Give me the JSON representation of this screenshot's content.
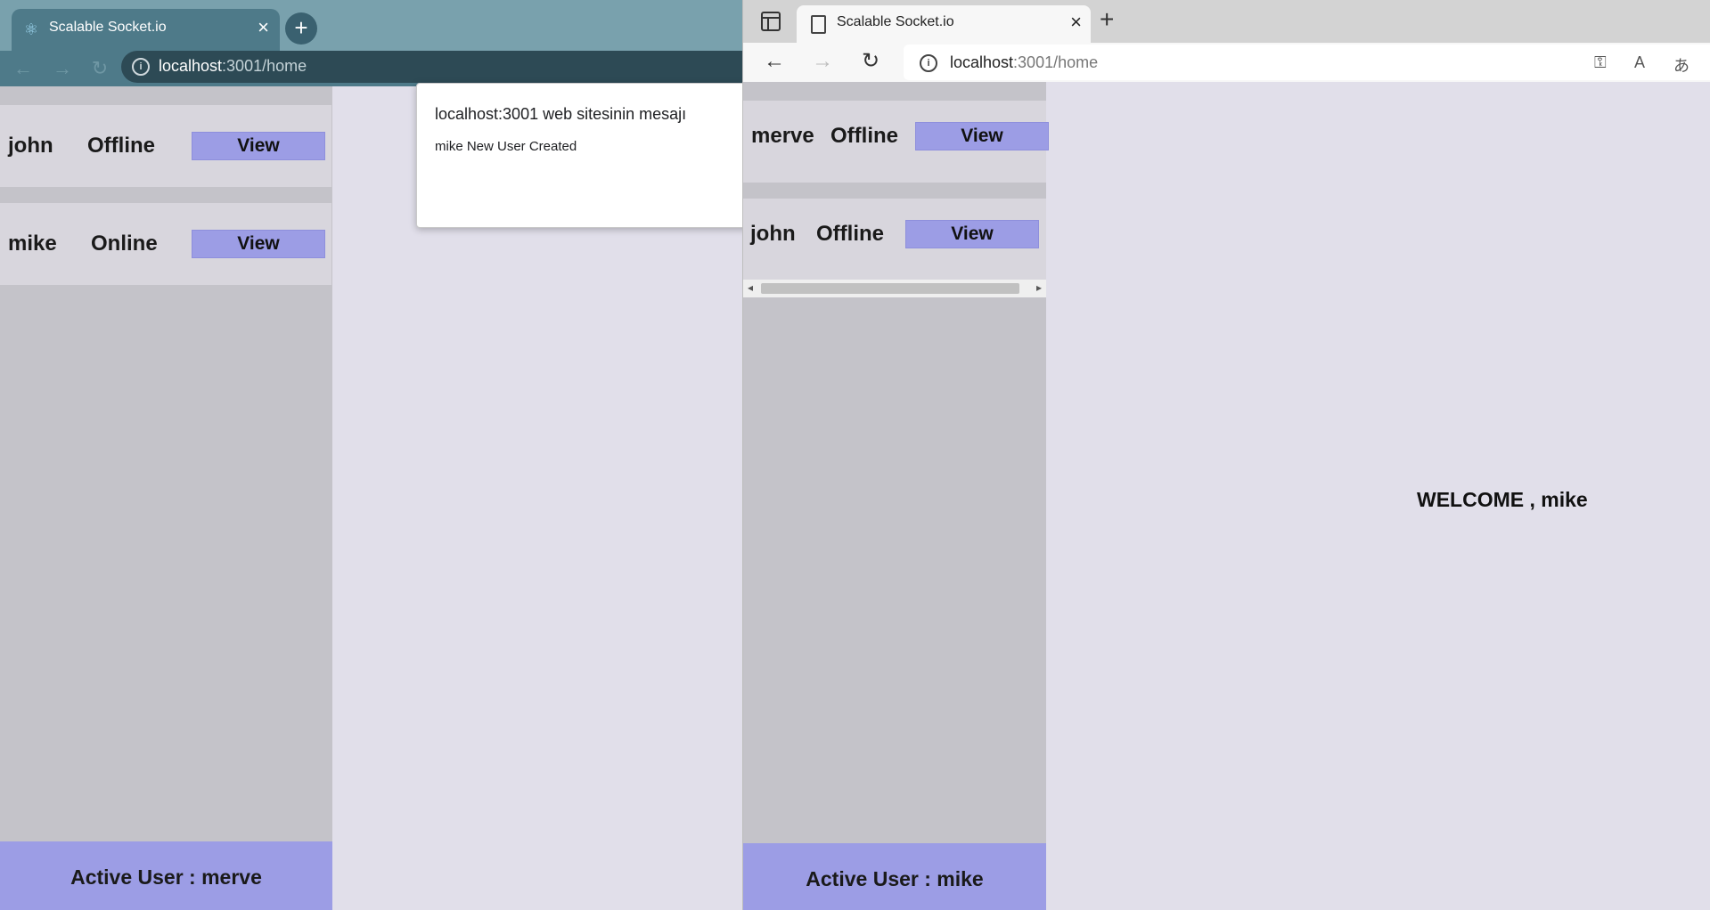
{
  "left_browser": {
    "tab_title": "Scalable Socket.io",
    "url_host": "localhost",
    "url_path": ":3001/home",
    "users": [
      {
        "name": "john",
        "status": "Offline",
        "button": "View"
      },
      {
        "name": "mike",
        "status": "Online",
        "button": "View"
      }
    ],
    "active_user": "Active User : merve",
    "alert": {
      "title": "localhost:3001 web sitesinin mesajı",
      "message": "mike New User Created"
    }
  },
  "right_browser": {
    "tab_title": "Scalable Socket.io",
    "url_host": "localhost",
    "url_path": ":3001/home",
    "users": [
      {
        "name": "merve",
        "status": "Offline",
        "button": "View"
      },
      {
        "name": "john",
        "status": "Offline",
        "button": "View"
      }
    ],
    "active_user": "Active User : mike",
    "welcome": "WELCOME , mike"
  },
  "icons": {
    "react": "react-logo-icon",
    "close": "close-icon",
    "new_tab": "plus-icon",
    "back": "back-arrow-icon",
    "forward": "forward-arrow-icon",
    "reload": "reload-icon",
    "info": "info-icon",
    "key": "key-icon",
    "read_aloud": "read-aloud-icon",
    "translate": "translate-icon",
    "favorite": "star-icon"
  },
  "colors": {
    "accent": "#9c9de5",
    "sidebar": "#c4c3c9",
    "card": "#d8d6dd",
    "page": "#e1dfea"
  }
}
